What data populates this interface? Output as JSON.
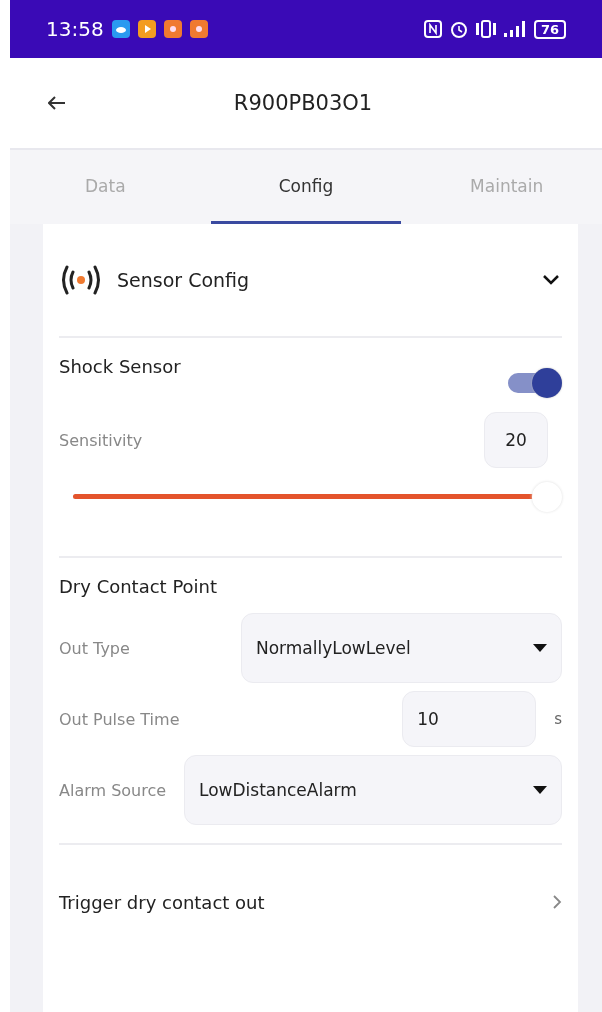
{
  "status_bar": {
    "time": "13:58",
    "battery": "76"
  },
  "header": {
    "title": "R900PB03O1"
  },
  "tabs": [
    {
      "label": "Data",
      "selected": false
    },
    {
      "label": "Config",
      "selected": true
    },
    {
      "label": "Maintain",
      "selected": false
    }
  ],
  "panel": {
    "title": "Sensor Config",
    "expanded": true
  },
  "shock_sensor": {
    "title": "Shock Sensor",
    "on": true,
    "sensitivity_label": "Sensitivity",
    "sensitivity_value": "20",
    "level": 1
  },
  "dry_contact": {
    "title": "Dry Contact Point",
    "fields": [
      {
        "kind": "select",
        "label": "Out Type",
        "value": "NormallyLowLevel"
      },
      {
        "kind": "number",
        "label": "Out Pulse Time",
        "value": "10",
        "unit": "s"
      },
      {
        "kind": "select",
        "label": "Alarm Source",
        "value": "LowDistanceAlarm"
      }
    ]
  },
  "trigger": {
    "label": "Trigger dry contact out"
  }
}
